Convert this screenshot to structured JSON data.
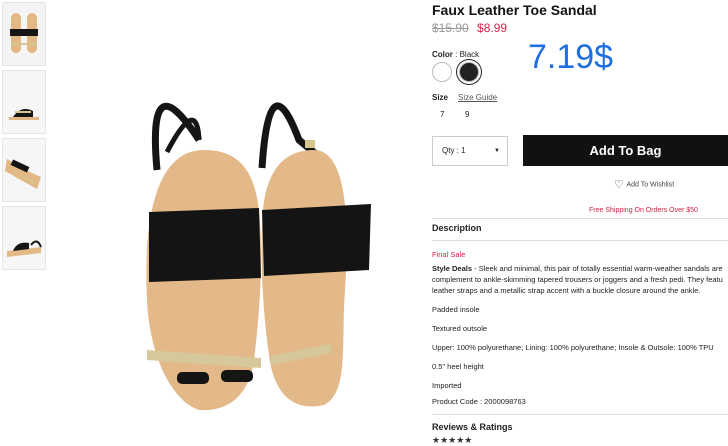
{
  "product": {
    "title": "Faux Leather Toe Sandal",
    "old_price": "$15.90",
    "new_price": "$8.99",
    "promo_price": "7.19$"
  },
  "color": {
    "label": "Color",
    "separator": ":",
    "value": "Black",
    "options": [
      "white",
      "black"
    ]
  },
  "size": {
    "label": "Size",
    "guide_label": "Size Guide",
    "options": [
      "7",
      "9"
    ]
  },
  "quantity": {
    "label": "Qty : 1"
  },
  "actions": {
    "add_to_bag": "Add To Bag",
    "wishlist": "Add To Wishlist"
  },
  "shipping_note": "Free Shipping On Orders Over $50",
  "description": {
    "heading": "Description",
    "final_sale": "Final Sale",
    "style_label": "Style Deals",
    "lines": [
      " - Sleek and minimal, this pair of totally essential warm-weather sandals are",
      "complement to ankle-skimming tapered trousers or joggers and a fresh pedi. They featu",
      "leather straps and a metallic strap accent with a buckle closure around the ankle."
    ],
    "features": [
      "Padded insole",
      "Textured outsole",
      "Upper: 100% polyurethane; Lining: 100% polyurethane; Insole & Outsole: 100% TPU",
      "0.5\" heel height",
      "Imported",
      "Product Code : 2000098763"
    ]
  },
  "reviews": {
    "heading": "Reviews & Ratings",
    "stars": "★★★★★"
  },
  "icons": [
    "heart-icon",
    "caret-down-icon"
  ]
}
